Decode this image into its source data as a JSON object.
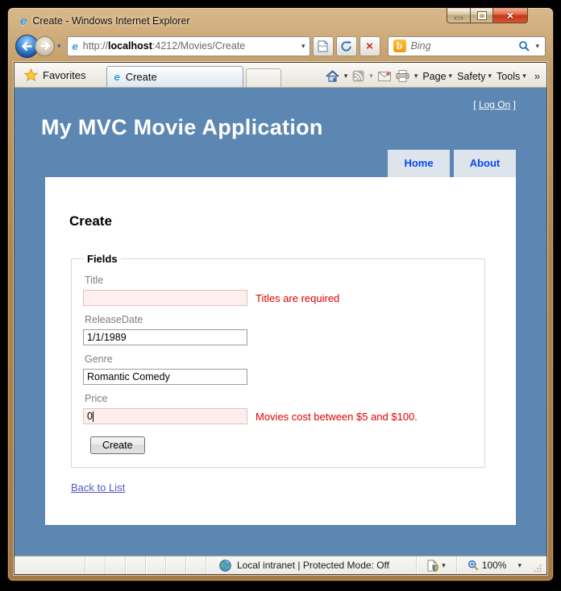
{
  "window": {
    "title": "Create - Windows Internet Explorer"
  },
  "address": {
    "prefix": "http://",
    "host": "localhost",
    "path": ":4212/Movies/Create"
  },
  "search": {
    "engine": "Bing"
  },
  "command": {
    "favorites": "Favorites",
    "tab": "Create",
    "page": "Page",
    "safety": "Safety",
    "tools": "Tools"
  },
  "icons": {
    "caret_down": "▾",
    "overflow_chevron": "»",
    "close_glyph": "×",
    "stop_glyph": "×",
    "bing_b": "b",
    "ie_e": "e"
  },
  "page": {
    "logon_open": "[",
    "logon_link": "Log On",
    "logon_close": "]",
    "app_title": "My MVC Movie Application",
    "nav": [
      {
        "label": "Home"
      },
      {
        "label": "About"
      }
    ],
    "heading": "Create",
    "form": {
      "legend": "Fields",
      "fields": [
        {
          "label": "Title",
          "value": "",
          "error": "Titles are required"
        },
        {
          "label": "ReleaseDate",
          "value": "1/1/1989",
          "error": ""
        },
        {
          "label": "Genre",
          "value": "Romantic Comedy",
          "error": ""
        },
        {
          "label": "Price",
          "value": "0",
          "error": "Movies cost between $5 and $100."
        }
      ],
      "submit": "Create"
    },
    "back_link": "Back to List"
  },
  "status": {
    "zone": "Local intranet | Protected Mode: Off",
    "zoom": "100%"
  },
  "colors": {
    "page_background": "#5c87b2",
    "nav_tab_bg": "#dde4ec",
    "nav_tab_text": "#034af3",
    "error_text": "#e20000",
    "error_input_bg": "#ffeeee",
    "link": "#505abc"
  }
}
